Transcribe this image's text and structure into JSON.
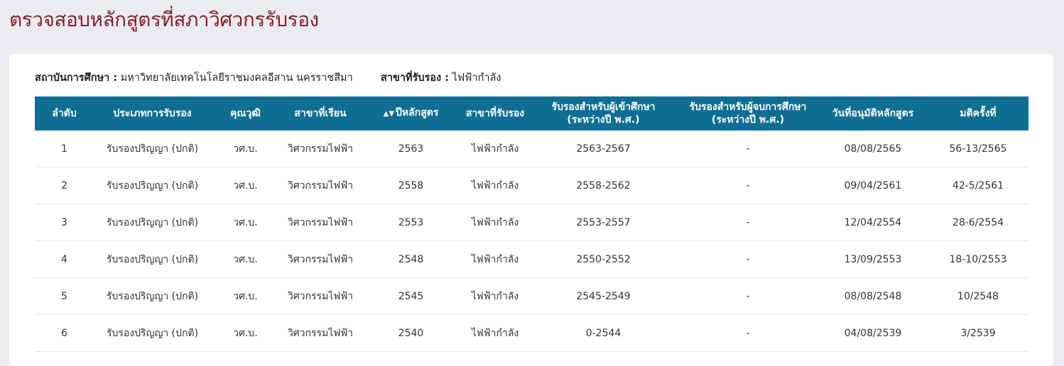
{
  "page": {
    "title": "ตรวจสอบหลักสูตรที่สภาวิศวกรรับรอง"
  },
  "info": {
    "institution_label": "สถาบันการศึกษา :",
    "institution_value": "มหาวิทยาลัยเทคโนโลยีราชมงคลอีสาน นครราชสีมา",
    "branch_label": "สาขาที่รับรอง :",
    "branch_value": "ไฟฟ้ากำลัง"
  },
  "table": {
    "headers": {
      "no": "ลำดับ",
      "type": "ประเภทการรับรอง",
      "degree": "คุณวุฒิ",
      "major": "สาขาที่เรียน",
      "year": "ปีหลักสูตร",
      "branch": "สาขาที่รับรอง",
      "entry_line1": "รับรองสำหรับผู้เข้าศึกษา",
      "entry_line2": "(ระหว่างปี พ.ศ.)",
      "grad_line1": "รับรองสำหรับผู้จบการศึกษา",
      "grad_line2": "(ระหว่างปี พ.ศ.)",
      "approve_date": "วันที่อนุมัติหลักสูตร",
      "resolution": "มติครั้งที่"
    },
    "sort_icon": "sort-icon",
    "rows": [
      {
        "no": "1",
        "type": "รับรองปริญญา (ปกติ)",
        "degree": "วศ.บ.",
        "major": "วิศวกรรมไฟฟ้า",
        "year": "2563",
        "branch": "ไฟฟ้ากำลัง",
        "entry": "2563-2567",
        "grad": "-",
        "approve_date": "08/08/2565",
        "resolution": "56-13/2565"
      },
      {
        "no": "2",
        "type": "รับรองปริญญา (ปกติ)",
        "degree": "วศ.บ.",
        "major": "วิศวกรรมไฟฟ้า",
        "year": "2558",
        "branch": "ไฟฟ้ากำลัง",
        "entry": "2558-2562",
        "grad": "-",
        "approve_date": "09/04/2561",
        "resolution": "42-5/2561"
      },
      {
        "no": "3",
        "type": "รับรองปริญญา (ปกติ)",
        "degree": "วศ.บ.",
        "major": "วิศวกรรมไฟฟ้า",
        "year": "2553",
        "branch": "ไฟฟ้ากำลัง",
        "entry": "2553-2557",
        "grad": "-",
        "approve_date": "12/04/2554",
        "resolution": "28-6/2554"
      },
      {
        "no": "4",
        "type": "รับรองปริญญา (ปกติ)",
        "degree": "วศ.บ.",
        "major": "วิศวกรรมไฟฟ้า",
        "year": "2548",
        "branch": "ไฟฟ้ากำลัง",
        "entry": "2550-2552",
        "grad": "-",
        "approve_date": "13/09/2553",
        "resolution": "18-10/2553"
      },
      {
        "no": "5",
        "type": "รับรองปริญญา (ปกติ)",
        "degree": "วศ.บ.",
        "major": "วิศวกรรมไฟฟ้า",
        "year": "2545",
        "branch": "ไฟฟ้ากำลัง",
        "entry": "2545-2549",
        "grad": "-",
        "approve_date": "08/08/2548",
        "resolution": "10/2548"
      },
      {
        "no": "6",
        "type": "รับรองปริญญา (ปกติ)",
        "degree": "วศ.บ.",
        "major": "วิศวกรรมไฟฟ้า",
        "year": "2540",
        "branch": "ไฟฟ้ากำลัง",
        "entry": "0-2544",
        "grad": "-",
        "approve_date": "04/08/2539",
        "resolution": "3/2539"
      }
    ]
  }
}
